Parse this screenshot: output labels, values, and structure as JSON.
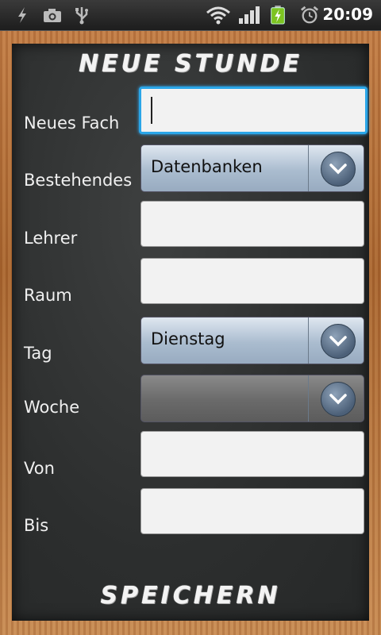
{
  "status_bar": {
    "time": "20:09",
    "icons": [
      "usb-debug-icon",
      "camera-icon",
      "usb-icon",
      "wifi-icon",
      "signal-icon",
      "battery-charging-icon",
      "alarm-icon"
    ]
  },
  "screen": {
    "title": "NEUE STUNDE",
    "save_label": "SPEICHERN"
  },
  "form": {
    "new_subject": {
      "label": "Neues Fach",
      "value": ""
    },
    "existing": {
      "label": "Bestehendes",
      "value": "Datenbanken"
    },
    "teacher": {
      "label": "Lehrer",
      "value": ""
    },
    "room": {
      "label": "Raum",
      "value": ""
    },
    "day": {
      "label": "Tag",
      "value": "Dienstag"
    },
    "week": {
      "label": "Woche",
      "value": ""
    },
    "from": {
      "label": "Von",
      "value": ""
    },
    "to": {
      "label": "Bis",
      "value": ""
    }
  }
}
